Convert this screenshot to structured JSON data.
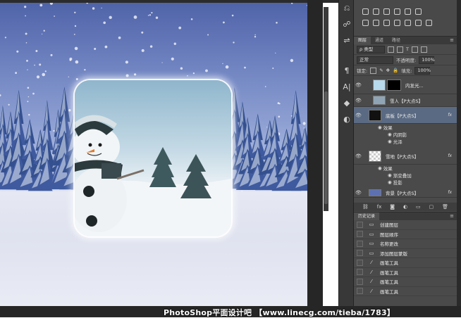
{
  "toolbar": {
    "icons": [
      "history-brush-icon",
      "puppet-warp-icon",
      "adjust-icon",
      "paragraph-icon",
      "character-icon",
      "3d-icon",
      "navigator-icon"
    ]
  },
  "layers_panel": {
    "tabs": [
      "图层",
      "通道",
      "路径"
    ],
    "filter_kind": "ρ 类型",
    "blend_mode": "正常",
    "opacity_label": "不透明度:",
    "opacity_value": "100%",
    "lock_label": "锁定:",
    "fill_label": "填充:",
    "fill_value": "100%",
    "layers": [
      {
        "name": "内发光...",
        "selected": false,
        "has_fx": false
      },
      {
        "name": "雪人【P大点S】",
        "selected": false,
        "has_fx": false
      },
      {
        "name": "底板【P大点S】",
        "selected": true,
        "has_fx": true,
        "fx_label": "fx"
      },
      {
        "name": "雪地【P大点S】",
        "selected": false,
        "has_fx": true,
        "fx_label": "fx"
      },
      {
        "name": "背景【P大点S】",
        "selected": false,
        "has_fx": true,
        "fx_label": "fx"
      }
    ],
    "effects_label": "效果",
    "base_effects": [
      "内阴影",
      "光泽"
    ],
    "snow_effects": [
      "渐变叠加",
      "投影"
    ]
  },
  "history_panel": {
    "tab": "历史记录",
    "items": [
      "创建图层",
      "图层顺序",
      "名称更改",
      "添加图层蒙版",
      "画笔工具",
      "画笔工具",
      "画笔工具",
      "画笔工具"
    ]
  },
  "watermark": "PhotoShop平面设计吧 【www.linecg.com/tieba/1783】"
}
